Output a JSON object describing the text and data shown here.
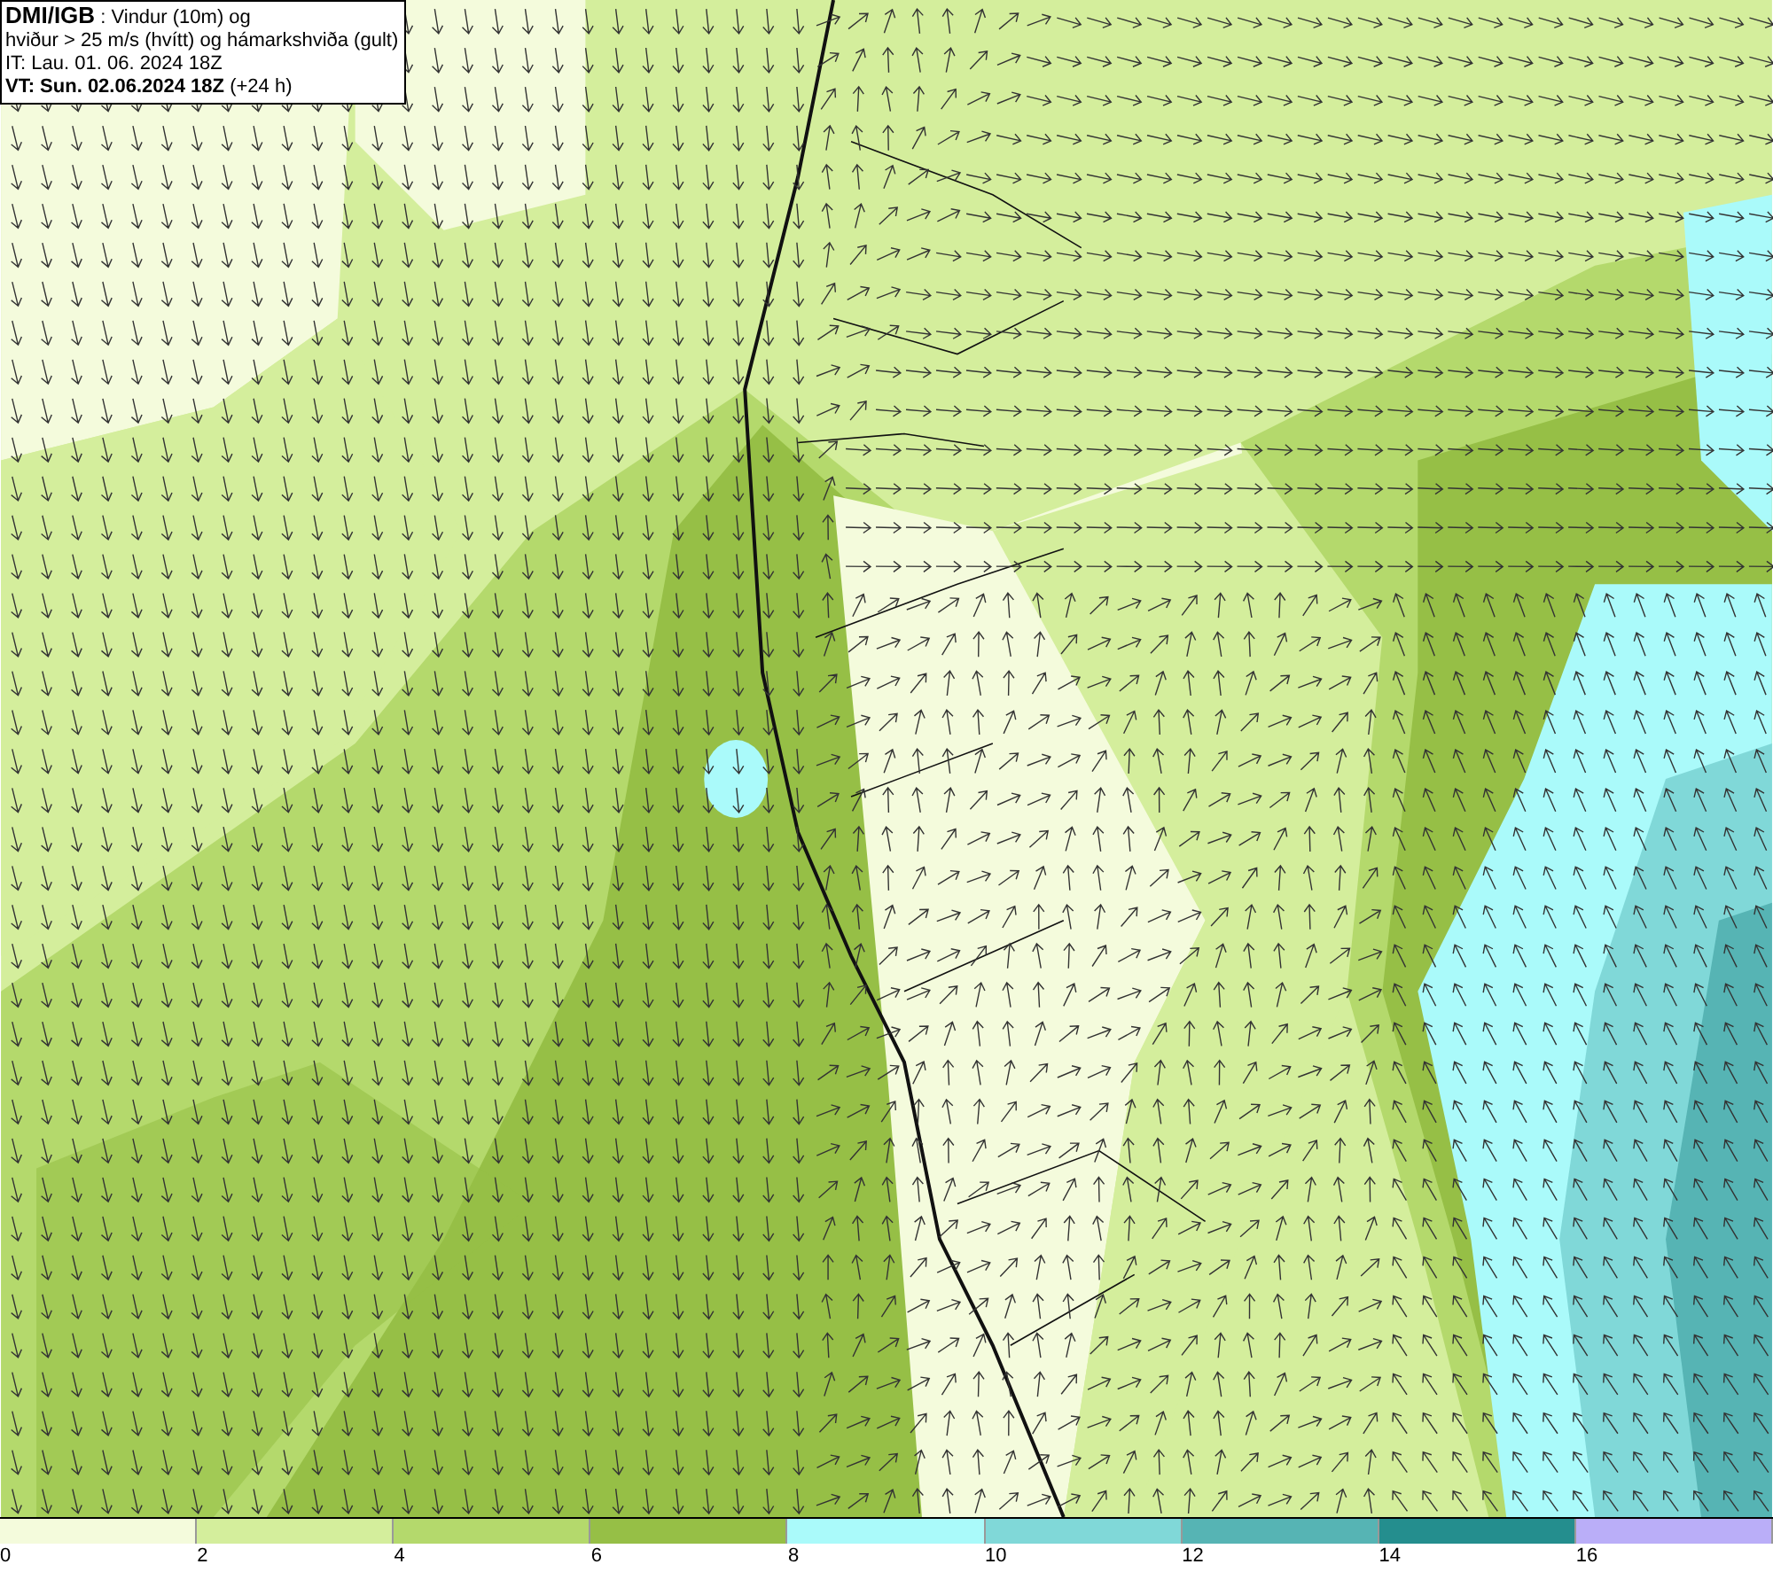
{
  "header": {
    "lines": [
      "**DMI/IGB** : Vindur (10m) og",
      "hviður > 25 m/s (hvítt) og hámarkshviða (gult)",
      "IT: Lau. 01. 06. 2024 18Z",
      "**VT: Sun. 02.06.2024 18Z** (+24 h)"
    ]
  },
  "legend": {
    "segments": [
      {
        "label": "0",
        "color": "#f4fbdc"
      },
      {
        "label": "2",
        "color": "#d4ee9c"
      },
      {
        "label": "4",
        "color": "#b4d96c"
      },
      {
        "label": "6",
        "color": "#96bf46"
      },
      {
        "label": "8",
        "color": "#aafafa"
      },
      {
        "label": "10",
        "color": "#80d8d8"
      },
      {
        "label": "12",
        "color": "#56b4b4"
      },
      {
        "label": "14",
        "color": "#248e8e"
      },
      {
        "label": "16",
        "color": "#baaef8"
      }
    ]
  }
}
